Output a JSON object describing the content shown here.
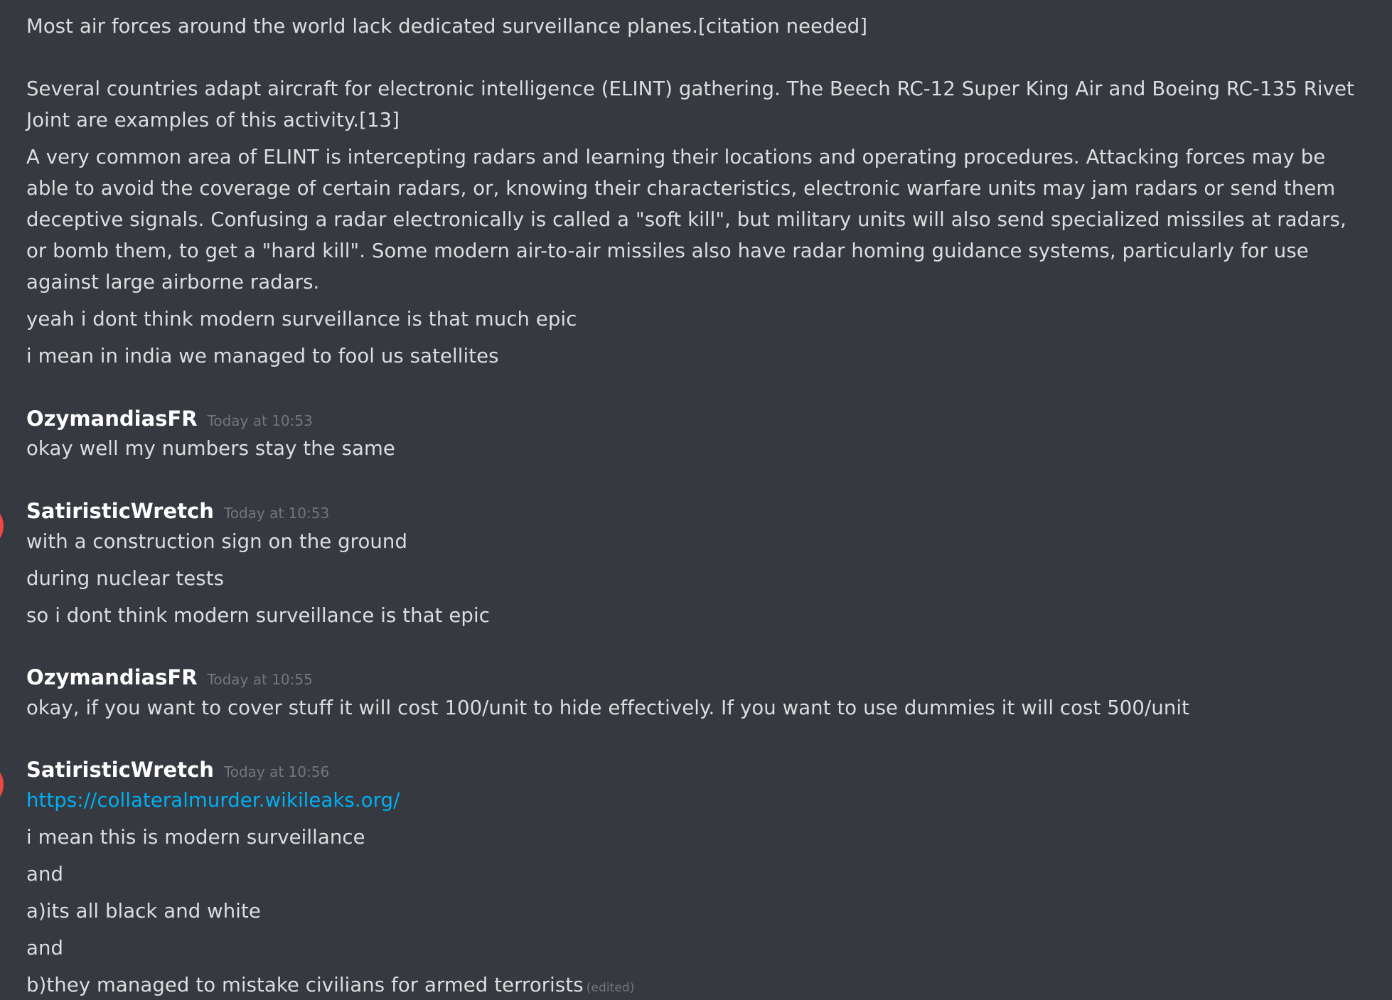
{
  "colors": {
    "background": "#36393f",
    "text": "#dcddde",
    "username": "#ffffff",
    "timestamp": "#72767d",
    "link": "#00b0f4",
    "avatar_edge": "#f04747"
  },
  "lead_messages": [
    "Most air forces around the world lack dedicated surveillance planes.[citation needed]",
    "Several countries adapt aircraft for electronic intelligence (ELINT) gathering. The Beech RC-12 Super King Air and Boeing RC-135 Rivet Joint are examples of this activity.[13]",
    "A very common area of ELINT is intercepting radars and learning their locations and operating procedures. Attacking forces may be able to avoid the coverage of certain radars, or, knowing their characteristics, electronic warfare units may jam radars or send them deceptive signals. Confusing a radar electronically is called a \"soft kill\", but military units will also send specialized missiles at radars, or bomb them, to get a \"hard kill\". Some modern air-to-air missiles also have radar homing guidance systems, particularly for use against large airborne radars.",
    "yeah i dont think modern surveillance is that much epic",
    "i mean in india we managed to fool us satellites"
  ],
  "groups": [
    {
      "author": "OzymandiasFR",
      "timestamp": "Today at 10:53",
      "messages": [
        "okay well my numbers stay the same"
      ]
    },
    {
      "author": "SatiristicWretch",
      "timestamp": "Today at 10:53",
      "avatar": "user-avatar",
      "messages": [
        "with a construction sign on the ground",
        "during nuclear tests",
        "so i dont think modern surveillance is that epic"
      ]
    },
    {
      "author": "OzymandiasFR",
      "timestamp": "Today at 10:55",
      "messages": [
        "okay, if you want to cover stuff it will cost 100/unit to hide effectively. If you want to use dummies it will cost 500/unit"
      ]
    },
    {
      "author": "SatiristicWretch",
      "timestamp": "Today at 10:56",
      "avatar": "user-avatar",
      "link": "https://collateralmurder.wikileaks.org/",
      "messages": [
        "i mean this is modern surveillance",
        "and",
        "a)its all black and white",
        "and",
        "b)they managed to mistake civilians for armed terrorists"
      ],
      "edited_label": "(edited)"
    }
  ]
}
